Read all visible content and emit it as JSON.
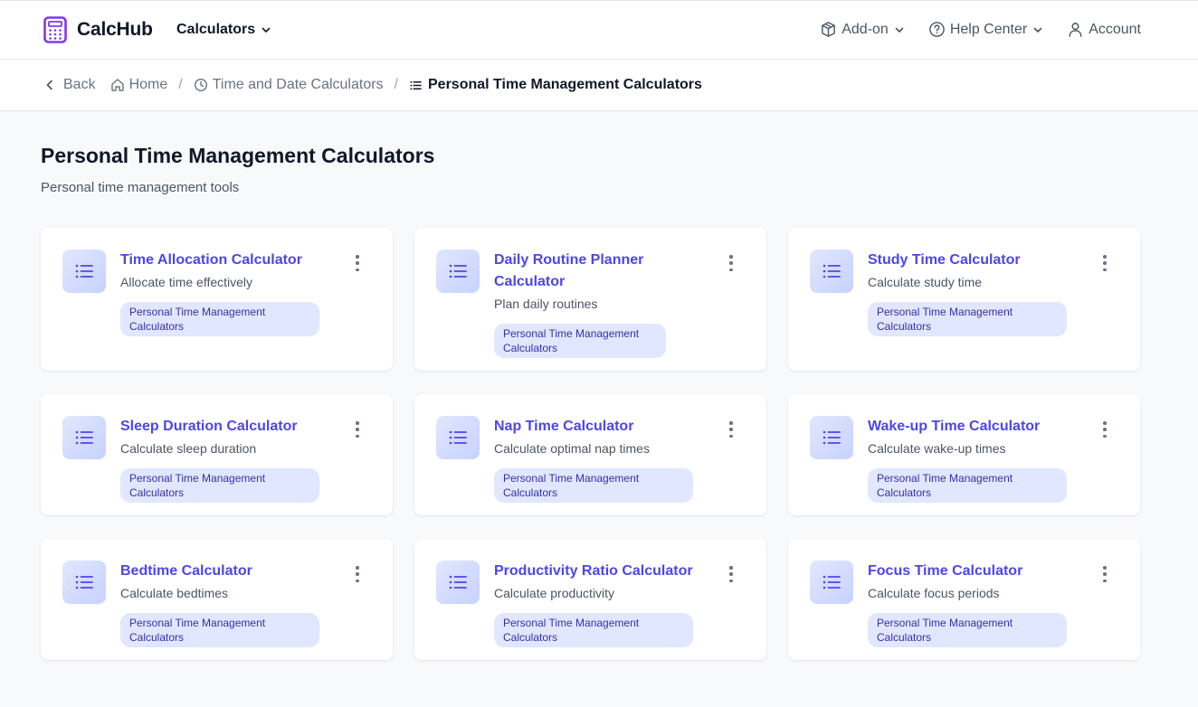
{
  "header": {
    "brand": "CalcHub",
    "nav_calculators": "Calculators",
    "addon": "Add-on",
    "help_center": "Help Center",
    "account": "Account"
  },
  "breadcrumb": {
    "back": "Back",
    "home": "Home",
    "parent": "Time and Date Calculators",
    "current": "Personal Time Management Calculators"
  },
  "page": {
    "title": "Personal Time Management Calculators",
    "subtitle": "Personal time management tools"
  },
  "cards": [
    {
      "title": "Time Allocation Calculator",
      "desc": "Allocate time effectively",
      "tag": "Personal Time Management Calculators"
    },
    {
      "title": "Daily Routine Planner Calculator",
      "desc": "Plan daily routines",
      "tag": "Personal Time Management Calculators"
    },
    {
      "title": "Study Time Calculator",
      "desc": "Calculate study time",
      "tag": "Personal Time Management Calculators"
    },
    {
      "title": "Sleep Duration Calculator",
      "desc": "Calculate sleep duration",
      "tag": "Personal Time Management Calculators"
    },
    {
      "title": "Nap Time Calculator",
      "desc": "Calculate optimal nap times",
      "tag": "Personal Time Management Calculators"
    },
    {
      "title": "Wake-up Time Calculator",
      "desc": "Calculate wake-up times",
      "tag": "Personal Time Management Calculators"
    },
    {
      "title": "Bedtime Calculator",
      "desc": "Calculate bedtimes",
      "tag": "Personal Time Management Calculators"
    },
    {
      "title": "Productivity Ratio Calculator",
      "desc": "Calculate productivity",
      "tag": "Personal Time Management Calculators"
    },
    {
      "title": "Focus Time Calculator",
      "desc": "Calculate focus periods",
      "tag": "Personal Time Management Calculators"
    }
  ],
  "colors": {
    "accent": "#4f46e5",
    "logo": "#7c3aed",
    "tag_bg": "#e0e7ff",
    "tag_text": "#3730a3"
  },
  "icons": {
    "brand": "calculator-icon",
    "card": "list-icon",
    "menu": "more-vertical-icon"
  }
}
